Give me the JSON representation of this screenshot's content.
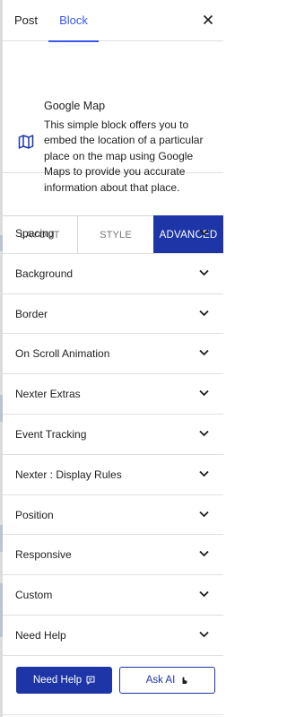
{
  "tabs": {
    "post": "Post",
    "block": "Block"
  },
  "block": {
    "title": "Google Map",
    "description": "This simple block offers you to embed the location of a particular place on the map using Google Maps to provide you accurate information about that place.",
    "icon": "map-icon"
  },
  "segments": {
    "layout": "LAYOUT",
    "style": "STYLE",
    "advanced": "ADVANCED",
    "active": "ADVANCED"
  },
  "accordion": [
    {
      "label": "Spacing"
    },
    {
      "label": "Background"
    },
    {
      "label": "Border"
    },
    {
      "label": "On Scroll Animation"
    },
    {
      "label": "Nexter Extras"
    },
    {
      "label": "Event Tracking"
    },
    {
      "label": "Nexter : Display Rules"
    },
    {
      "label": "Position"
    },
    {
      "label": "Responsive"
    },
    {
      "label": "Custom"
    },
    {
      "label": "Need Help"
    }
  ],
  "footer": {
    "need_help": "Need Help",
    "ask_ai": "Ask AI"
  },
  "colors": {
    "accent": "#3858e9",
    "primary": "#1d35a7",
    "border": "#e0e0e0",
    "text": "#1e1e1e"
  }
}
